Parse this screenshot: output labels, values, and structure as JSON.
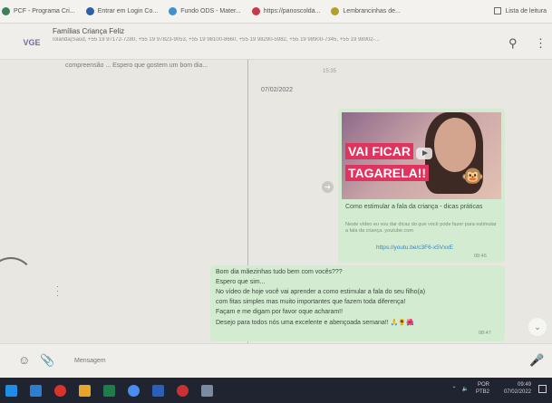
{
  "bookmarks": [
    {
      "label": "PCF - Programa Cri...",
      "color": "#3f7f5a"
    },
    {
      "label": "Entrar em Login Co...",
      "color": "#2b5fa8"
    },
    {
      "label": "Fundo ODS - Mater...",
      "color": "#3d92c9"
    },
    {
      "label": "https://panoscolda...",
      "color": "#c73a4a"
    },
    {
      "label": "Lembrancinhas de...",
      "color": "#b0a12e"
    }
  ],
  "bookmarks_right": {
    "label": "Lista de leitura"
  },
  "header": {
    "avatar_text": "VGE",
    "group_name": "Famílias Criança Feliz",
    "members": "Iolanda(Saúd, +55 19 97172-7280, +55 19 97823-9053, +55 19 98100-8660, +55 19 98290-5982, +55 19 98900-7345, +55 19 98902-...",
    "search_icon": "search-icon",
    "menu_icon": "kebab-menu-icon"
  },
  "chat": {
    "pinned_note": "compreensão ... Espero que gostem um bom dia...",
    "today_label": "15:35",
    "date_chip": "07/02/2022",
    "video_message": {
      "title_line1": "VAI FICAR",
      "title_line2": "TAGARELA!!",
      "link_title": "Como estimular a fala da criança - dicas práticas",
      "link_desc": "Neste vídeo eu vou dar dicas do que você pode fazer para estimular a fala da criança. youtube.com",
      "url": "https://youtu.be/c3F6-x5VxxE",
      "time": "08:46"
    },
    "text_message": {
      "lines": [
        "Bom dia mãezinhas tudo bem com vocês???",
        "Espero que sim...",
        "No vídeo de hoje você vai aprender a como estimular a fala do seu filho(a)",
        "com fitas simples mas muito importantes que fazem toda diferença!",
        "Façam e me digam por favor oque acharam!!",
        "Desejo para todos nós uma excelente e abençoada semana!! 🙏🌻🌺"
      ],
      "time": "08:47"
    }
  },
  "composer": {
    "placeholder": "Mensagem",
    "emoji_icon": "emoji-icon",
    "attach_icon": "paperclip-icon",
    "mic_icon": "microphone-icon"
  },
  "taskbar": {
    "icons": [
      "windows-start-icon",
      "search-icon",
      "opera-icon",
      "files-icon",
      "excel-icon",
      "chrome-icon",
      "word-icon",
      "media-icon",
      "app-icon"
    ],
    "colors": [
      "#1e8de6",
      "#2b7fd3",
      "#d9342b",
      "#e8a52a",
      "#1e7d4a",
      "#4a8df0",
      "#2b5fb8",
      "#c83232",
      "#7a8aa0"
    ],
    "lang": "POR",
    "lang_sub": "PTB2",
    "time": "09:49",
    "date": "07/02/2022"
  }
}
